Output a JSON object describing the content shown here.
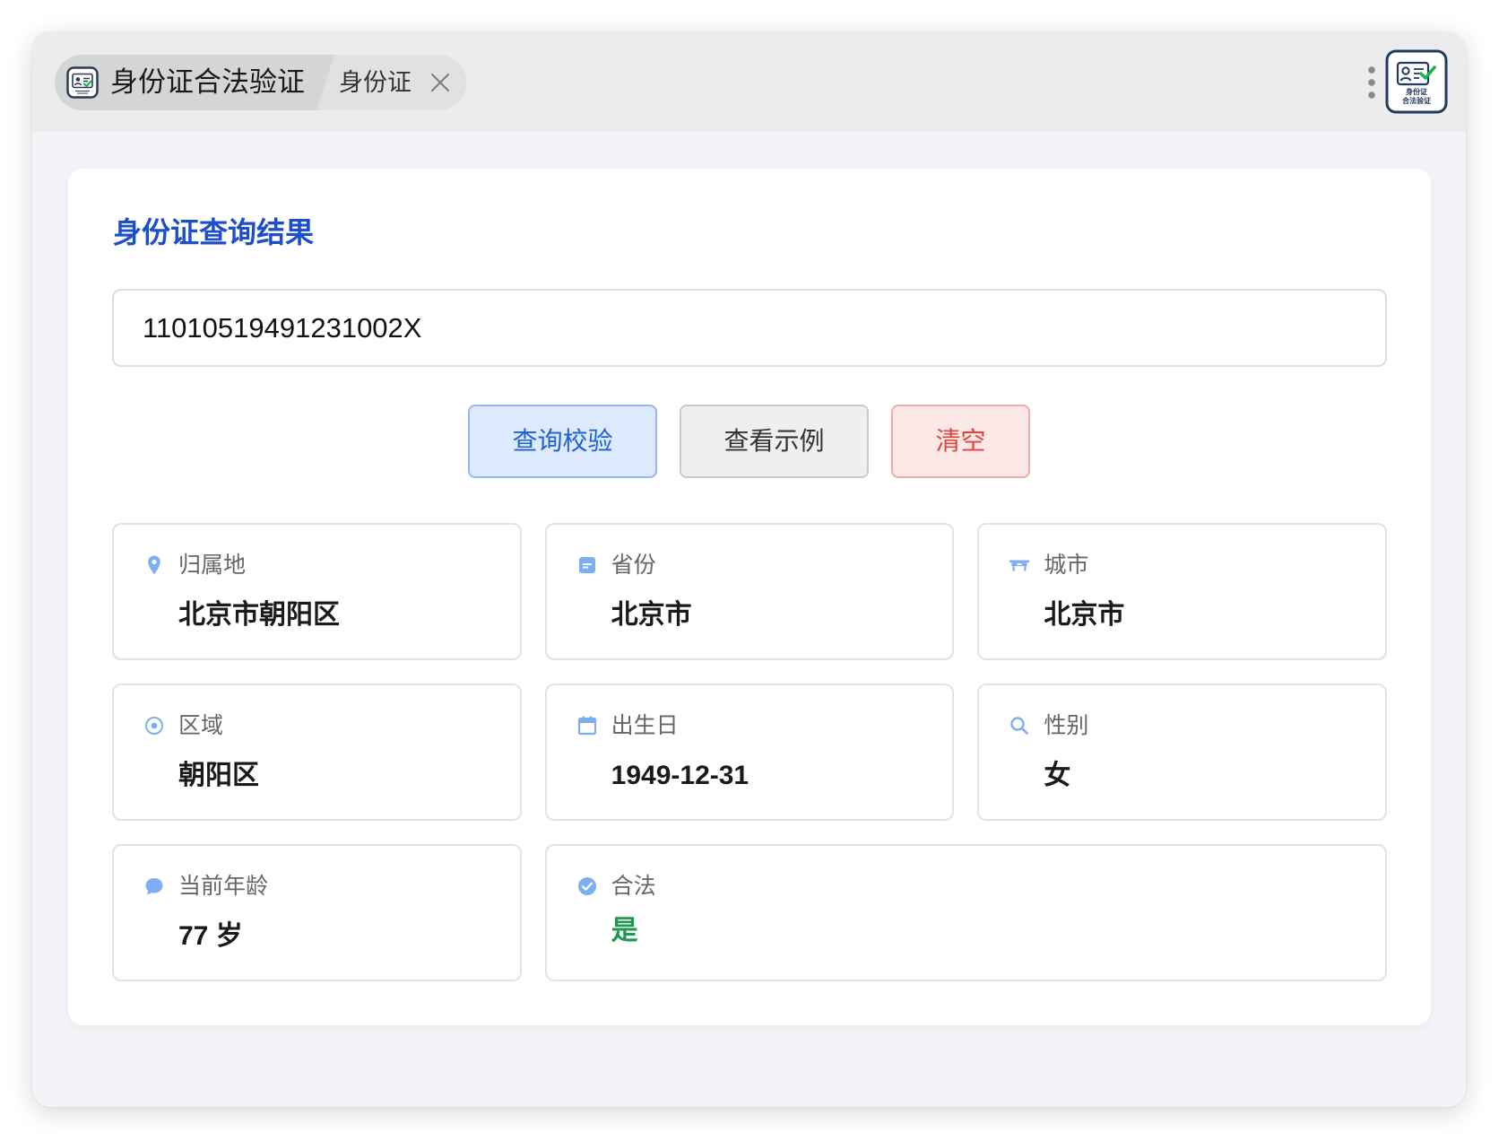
{
  "window": {
    "tabs": [
      {
        "label": "身份证合法验证",
        "active": true,
        "icon": "id-card-check-icon"
      },
      {
        "label": "身份证",
        "active": false,
        "closable": true,
        "close_icon": "close-icon"
      }
    ],
    "menu_icon": "kebab-menu-icon",
    "app_icon": {
      "icon": "id-card-verify-app-icon",
      "logo_text": [
        "身份证",
        "合法验证"
      ]
    }
  },
  "main": {
    "title": "身份证查询结果",
    "id_input": {
      "value": "11010519491231002X"
    },
    "buttons": {
      "query": "查询校验",
      "example": "查看示例",
      "clear": "清空"
    },
    "results": [
      {
        "label": "归属地",
        "value": "北京市朝阳区",
        "icon": "location-pin-icon"
      },
      {
        "label": "省份",
        "value": "北京市",
        "icon": "province-card-icon"
      },
      {
        "label": "城市",
        "value": "北京市",
        "icon": "city-icon"
      },
      {
        "label": "区域",
        "value": "朝阳区",
        "icon": "district-target-icon"
      },
      {
        "label": "出生日",
        "value": "1949-12-31",
        "icon": "calendar-icon"
      },
      {
        "label": "性别",
        "value": "女",
        "icon": "search-icon"
      },
      {
        "label": "当前年龄",
        "value": "77 岁",
        "icon": "chat-bubble-icon"
      },
      {
        "label": "合法",
        "value": "是",
        "icon": "check-circle-icon"
      }
    ]
  },
  "colors": {
    "heading": "#1c4fc9",
    "result_icon": "#7eaef2",
    "legal_yes": "#1d9a52",
    "query_button_text": "#1e62d2",
    "query_button_bg": "#dde9fd",
    "clear_button_text": "#e0443c",
    "clear_button_bg": "#fde8e8",
    "page_bg": "#f3f4f7"
  }
}
